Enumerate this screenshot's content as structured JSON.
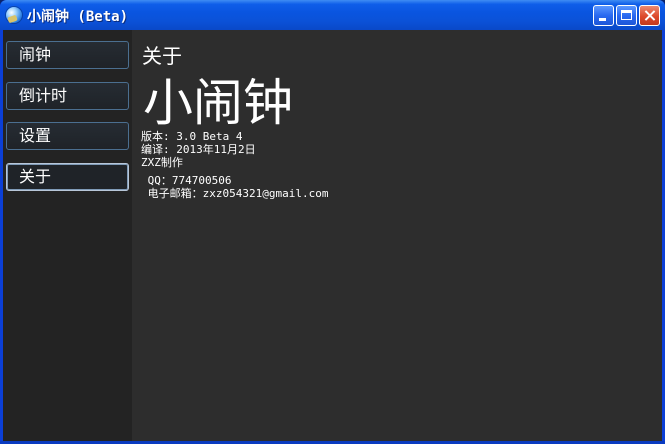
{
  "window": {
    "title": "小闹钟 (Beta)",
    "app_icon": "alarm-clock-icon",
    "controls": [
      "minimize-icon",
      "maximize-icon",
      "close-icon"
    ]
  },
  "sidebar": {
    "items": [
      {
        "label": "闹钟"
      },
      {
        "label": "倒计时"
      },
      {
        "label": "设置"
      },
      {
        "label": "关于",
        "active": true
      }
    ]
  },
  "about": {
    "section_title": "关于",
    "app_name": "小闹钟",
    "version": "版本: 3.0 Beta 4",
    "build": "编译: 2013年11月2日",
    "author": "ZXZ制作",
    "qq": " QQ：774700506",
    "email": " 电子邮箱：zxz054321@gmail.com"
  },
  "colors": {
    "titlebar": "#0a55e0",
    "sidebar_bg": "#232323",
    "content_bg": "#2d2d2d",
    "text": "#ffffff",
    "button_border": "#4b6f90"
  }
}
